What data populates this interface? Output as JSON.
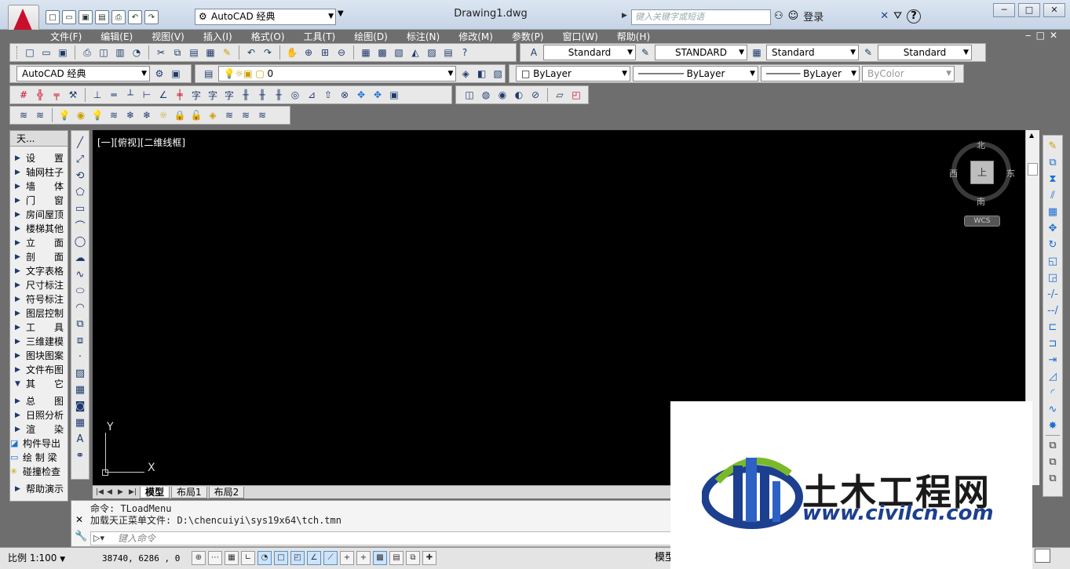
{
  "titlebar": {
    "workspace": "AutoCAD 经典",
    "document": "Drawing1.dwg",
    "search_placeholder": "键入关键字或短语",
    "login": "登录",
    "help": "?"
  },
  "menu": [
    "文件(F)",
    "编辑(E)",
    "视图(V)",
    "插入(I)",
    "格式(O)",
    "工具(T)",
    "绘图(D)",
    "标注(N)",
    "修改(M)",
    "参数(P)",
    "窗口(W)",
    "帮助(H)"
  ],
  "styles": {
    "text_style": "Standard",
    "dim_style": "STANDARD",
    "table_style": "Standard",
    "mleader_style": "Standard"
  },
  "layers": {
    "workspace": "AutoCAD 经典",
    "layer": "0",
    "color": "ByLayer",
    "linetype": "ByLayer",
    "lineweight": "ByLayer",
    "plotstyle": "ByColor"
  },
  "palette": {
    "title": "天...",
    "items": [
      "设　　置",
      "轴网柱子",
      "墙　　体",
      "门　　窗",
      "房间屋顶",
      "楼梯其他",
      "立　　面",
      "剖　　面",
      "文字表格",
      "尺寸标注",
      "符号标注",
      "图层控制",
      "工　　具",
      "三维建模",
      "图块图案",
      "文件布图",
      "其　　它"
    ],
    "items2": [
      "总　　图",
      "日照分析",
      "渲　　染"
    ],
    "tools": [
      "构件导出",
      "绘 制 梁",
      "碰撞检查"
    ],
    "last": "帮助演示"
  },
  "viewport": {
    "label": "[一][俯视][二维线框]",
    "north": "北",
    "south": "南",
    "east": "东",
    "west": "西",
    "top_face": "上",
    "wcs": "WCS",
    "ucs_x": "X",
    "ucs_y": "Y"
  },
  "tabs": [
    "模型",
    "布局1",
    "布局2"
  ],
  "command": {
    "line1": "命令: TLoadMenu",
    "line2": "加载天正菜单文件: D:\\chencuiyi\\sys19x64\\tch.tmn",
    "placeholder": "键入命令"
  },
  "status": {
    "scale": "比例 1:100",
    "coords": "38740, 6286 , 0",
    "model": "模型"
  },
  "watermark": {
    "name": "土木工程网",
    "url": "www.civilcn.com"
  },
  "colors": {
    "accent_red": "#c8102e",
    "icon_blue": "#1d6fd0",
    "canvas": "#000000",
    "watermark_blue": "#1d3f8f",
    "watermark_green": "#7ab929"
  }
}
